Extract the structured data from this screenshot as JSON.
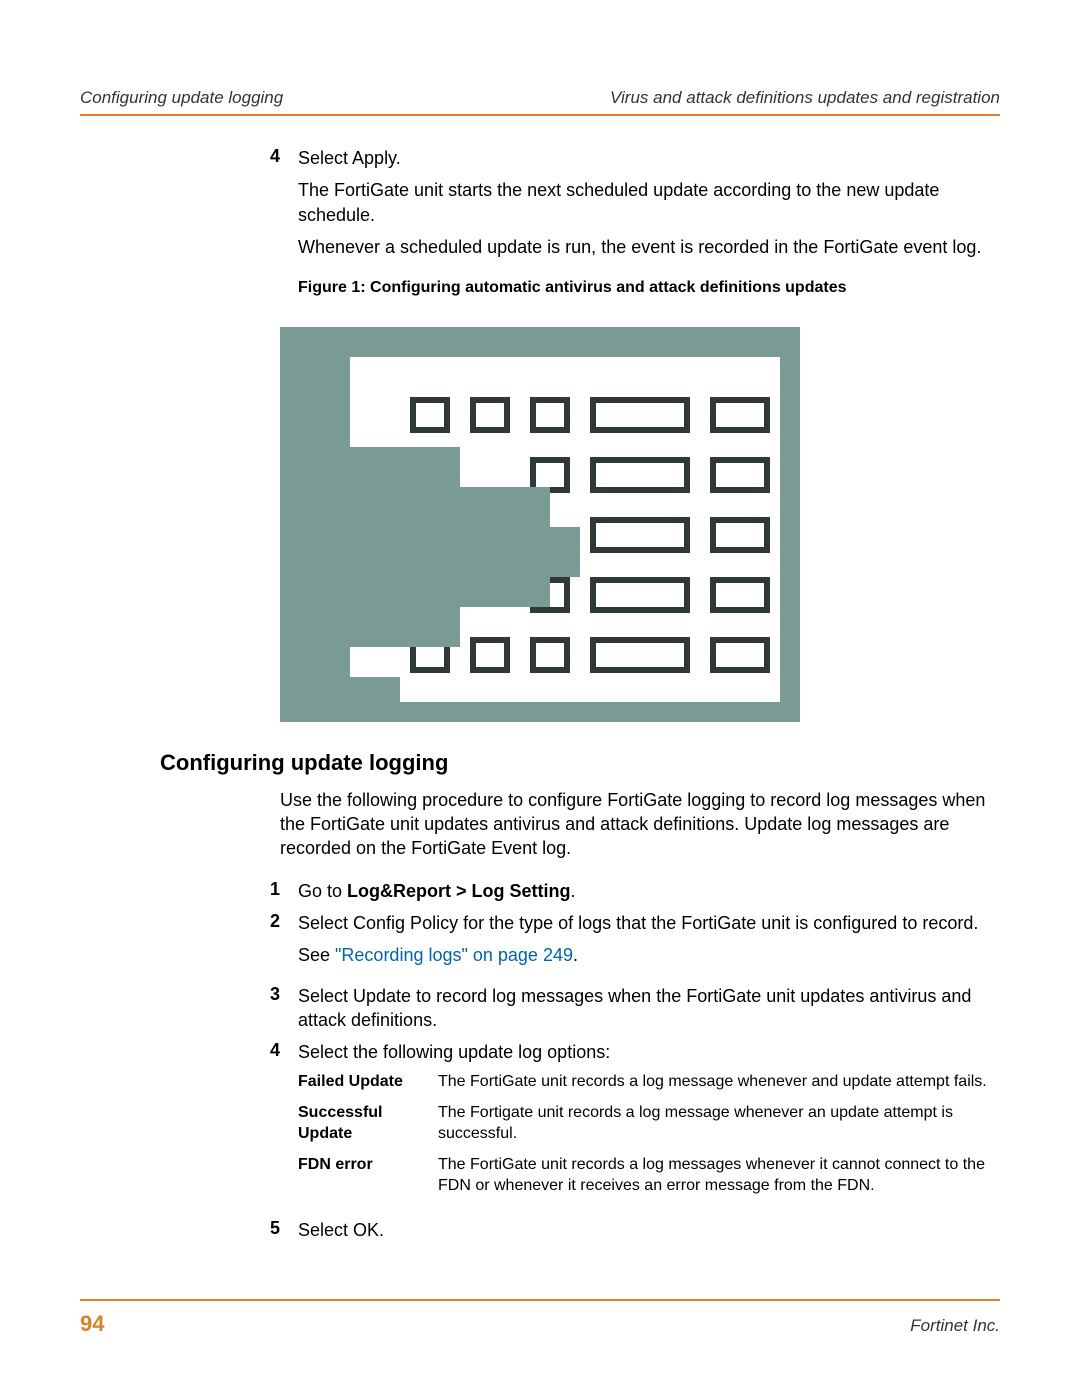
{
  "header": {
    "left": "Configuring update logging",
    "right": "Virus and attack definitions updates and registration"
  },
  "topStep": {
    "num": "4",
    "line1": "Select Apply.",
    "line2": "The FortiGate unit starts the next scheduled update according to the new update schedule.",
    "line3": "Whenever a scheduled update is run, the event is recorded in the FortiGate event log."
  },
  "figureCaption": "Figure 1:  Configuring automatic antivirus and attack definitions updates",
  "sectionHeading": "Configuring update logging",
  "sectionIntro": "Use the following procedure to configure FortiGate logging to record log messages when the FortiGate unit updates antivirus and attack definitions. Update log messages are recorded on the FortiGate Event log.",
  "steps": [
    {
      "num": "1",
      "prefix": "Go to ",
      "bold": "Log&Report > Log Setting",
      "suffix": "."
    },
    {
      "num": "2",
      "text": "Select Config Policy for the type of logs that the FortiGate unit is configured to record.",
      "linkPrefix": "See ",
      "link": "\"Recording logs\" on page 249",
      "linkSuffix": "."
    },
    {
      "num": "3",
      "text": "Select Update to record log messages when the FortiGate unit updates antivirus and attack definitions."
    },
    {
      "num": "4",
      "text": "Select the following update log options:"
    }
  ],
  "options": [
    {
      "label": "Failed Update",
      "desc": "The FortiGate unit records a log message whenever and update attempt fails."
    },
    {
      "label": "Successful Update",
      "desc": "The Fortigate unit records a log message whenever an update attempt is successful."
    },
    {
      "label": "FDN error",
      "desc": "The FortiGate unit records a log messages whenever it cannot connect to the FDN or whenever it receives an error message from the FDN."
    }
  ],
  "step5": {
    "num": "5",
    "text": "Select OK."
  },
  "footer": {
    "page": "94",
    "company": "Fortinet Inc."
  }
}
